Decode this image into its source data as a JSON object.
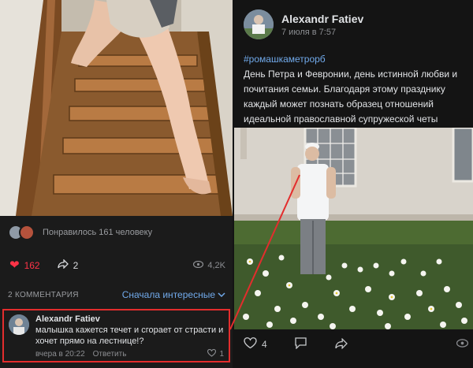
{
  "left_post": {
    "likes_summary": "Понравилось 161 человеку",
    "likes_count": "162",
    "shares_count": "2",
    "views_count": "4,2K",
    "comments_label": "2 КОММЕНТАРИЯ",
    "sort_label": "Сначала интересные",
    "comment": {
      "author": "Alexandr Fatiev",
      "text": "малышка кажется течет и сгорает от страсти и хочет прямо на лестнице!?",
      "time": "вчера в 20:22",
      "reply_label": "Ответить",
      "likes": "1"
    }
  },
  "right_post": {
    "author": "Alexandr Fatiev",
    "date": "7 июля в 7:57",
    "hashtag": "#ромашкаметрорб",
    "text": "День Петра и Февронии, день истинной любви и почитания семьи. Благодаря этому празднику каждый может познать образец отношений идеальной православной супружеской четы",
    "likes_count": "4"
  },
  "colors": {
    "accent_blue": "#71aaeb",
    "like_red": "#ff3347",
    "highlight_red": "#e32d2d"
  },
  "icons": [
    "heart-icon",
    "share-icon",
    "eye-icon",
    "chevron-down-icon",
    "comment-icon"
  ]
}
